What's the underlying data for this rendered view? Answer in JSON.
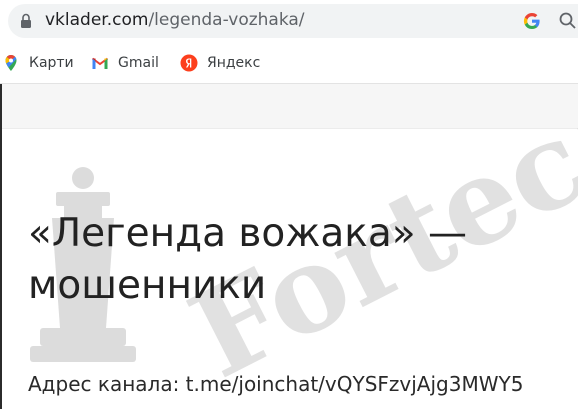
{
  "browser": {
    "url": {
      "host": "vklader.com",
      "path": "/legenda-vozhaka/"
    }
  },
  "bookmarks": [
    {
      "label": "Карти",
      "icon": "google-maps-icon"
    },
    {
      "label": "Gmail",
      "icon": "gmail-icon"
    },
    {
      "label": "Яндекс",
      "icon": "yandex-icon"
    }
  ],
  "article": {
    "title": "«Легенда вожака» — мошенники",
    "channel_line": "Адрес канала: t.me/joinchat/vQYSFzvjAjg3MWY5"
  },
  "watermark": {
    "text": "Forteck",
    "color": "#d9d9d9"
  },
  "colors": {
    "omnibox_bg": "#f1f3f4",
    "page_band": "#f6f6f6",
    "text": "#222222"
  }
}
